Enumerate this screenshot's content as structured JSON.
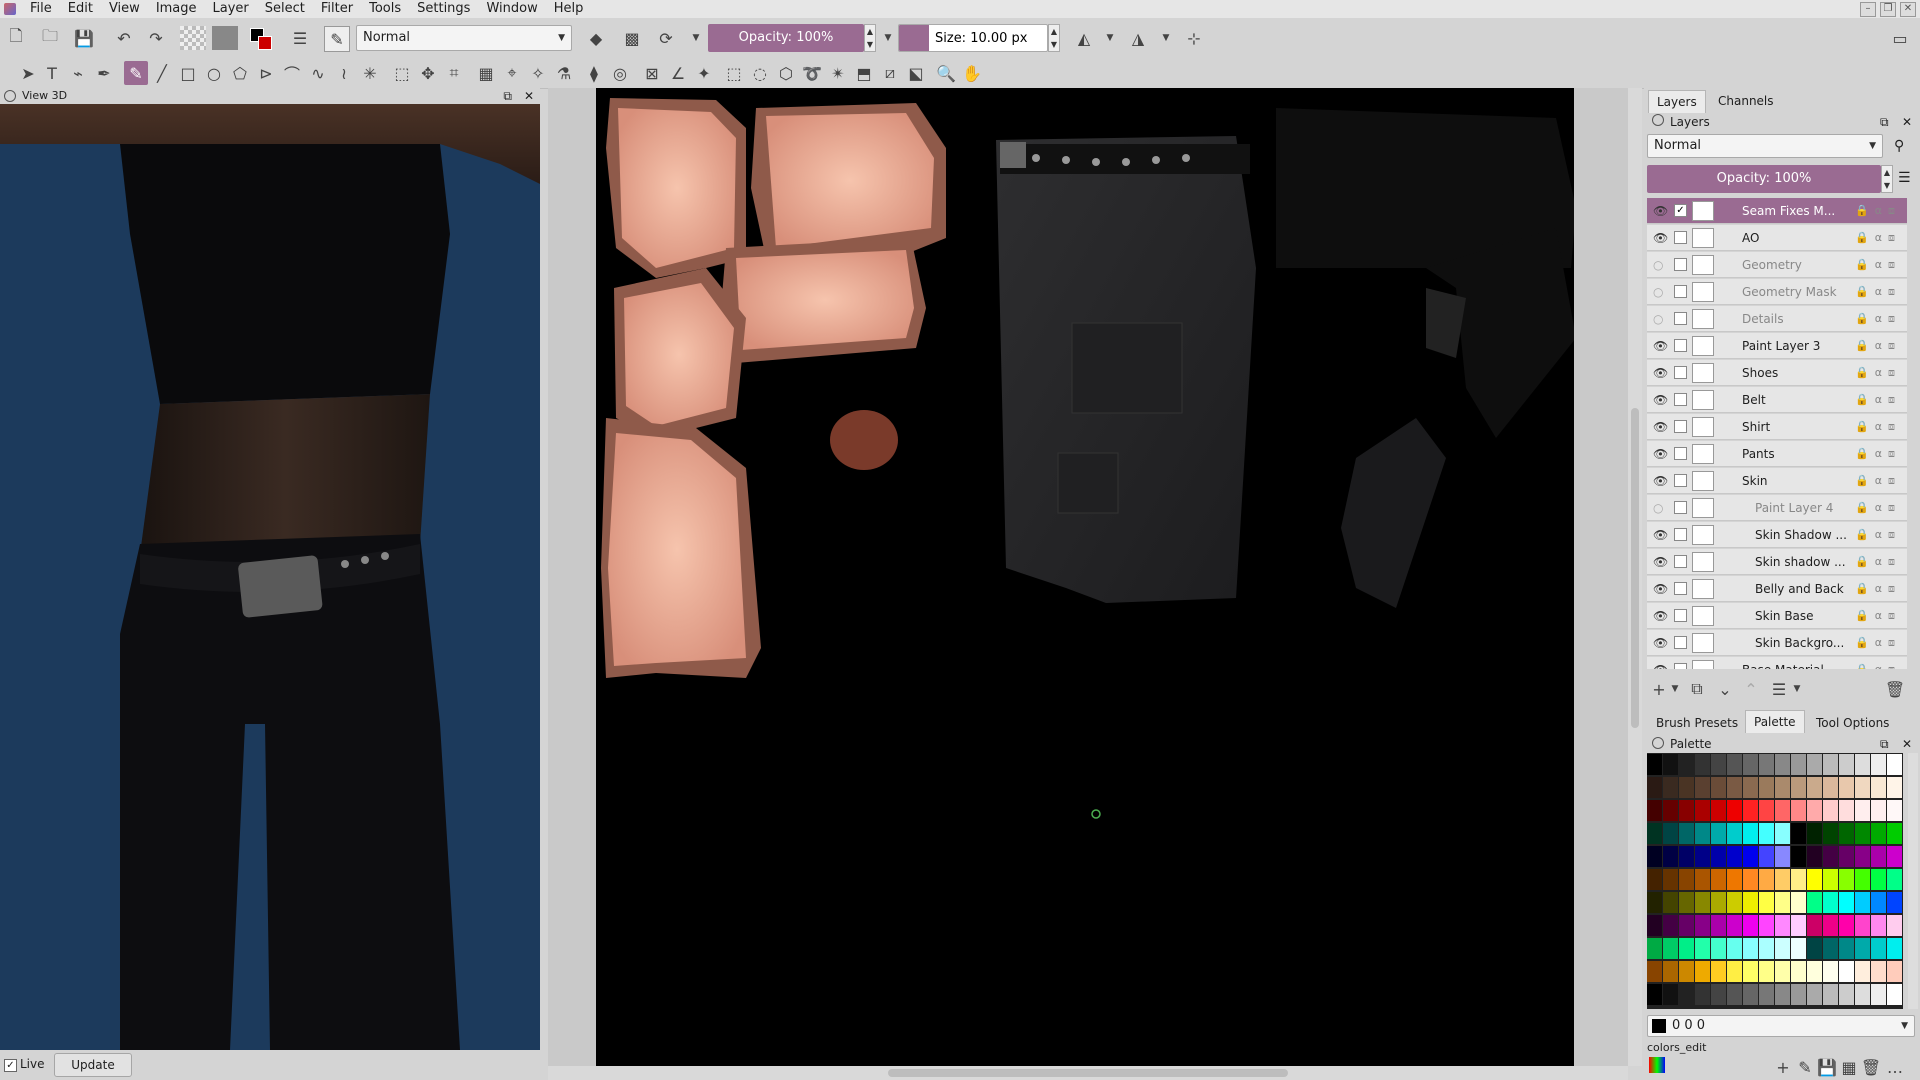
{
  "menubar": {
    "items": [
      "File",
      "Edit",
      "View",
      "Image",
      "Layer",
      "Select",
      "Filter",
      "Tools",
      "Settings",
      "Window",
      "Help"
    ]
  },
  "toolbar": {
    "blend_mode": "Normal",
    "opacity": "Opacity: 100%",
    "size": "Size: 10.00 px"
  },
  "view3d": {
    "title": "View 3D",
    "live_label": "Live",
    "update_label": "Update"
  },
  "layers_panel": {
    "tabs": [
      "Layers",
      "Channels"
    ],
    "title": "Layers",
    "blend_mode": "Normal",
    "opacity": "Opacity: 100%",
    "layers": [
      {
        "name": "Seam Fixes M...",
        "selected": true,
        "visible": true,
        "checked": true,
        "child": false
      },
      {
        "name": "AO",
        "visible": true,
        "child": false
      },
      {
        "name": "Geometry",
        "visible": false,
        "child": false
      },
      {
        "name": "Geometry Mask",
        "visible": false,
        "child": false
      },
      {
        "name": "Details",
        "visible": false,
        "child": false
      },
      {
        "name": "Paint Layer 3",
        "visible": true,
        "child": false
      },
      {
        "name": "Shoes",
        "visible": true,
        "child": false
      },
      {
        "name": "Belt",
        "visible": true,
        "child": false
      },
      {
        "name": "Shirt",
        "visible": true,
        "child": false
      },
      {
        "name": "Pants",
        "visible": true,
        "child": false
      },
      {
        "name": "Skin",
        "visible": true,
        "child": false
      },
      {
        "name": "Paint Layer 4",
        "visible": false,
        "child": true
      },
      {
        "name": "Skin Shadow ...",
        "visible": true,
        "child": true
      },
      {
        "name": "Skin shadow ...",
        "visible": true,
        "child": true
      },
      {
        "name": "Belly and Back",
        "visible": true,
        "child": true
      },
      {
        "name": "Skin Base",
        "visible": true,
        "child": true
      },
      {
        "name": "Skin Backgro...",
        "visible": true,
        "child": true
      },
      {
        "name": "Base Material",
        "visible": true,
        "child": false
      }
    ]
  },
  "lower_panel": {
    "tabs": [
      "Brush Presets",
      "Palette",
      "Tool Options"
    ],
    "title": "Palette",
    "color_value": "0 0 0",
    "palette_name": "colors_edit"
  },
  "colors": {
    "accent": "#9a6b92",
    "viewport_bg": "#1c3a5c"
  }
}
